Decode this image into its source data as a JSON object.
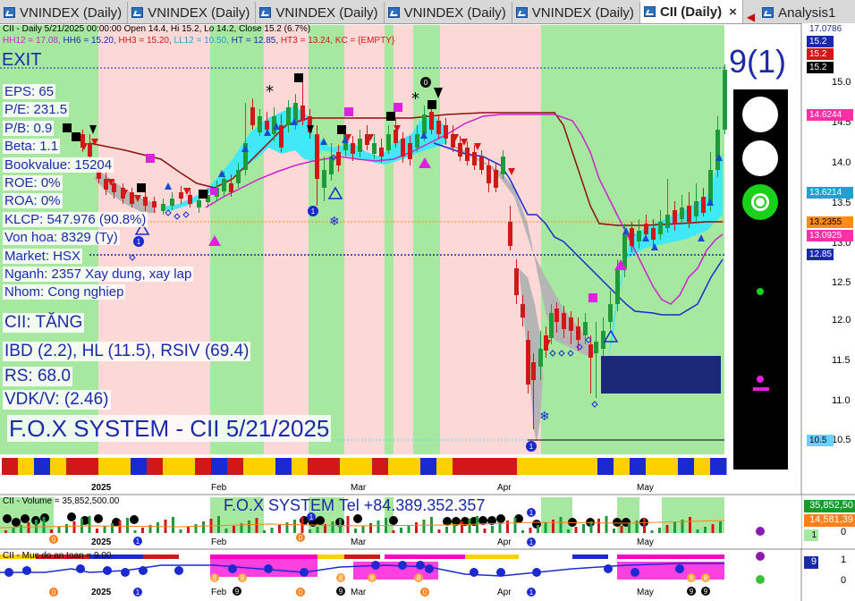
{
  "tabs": [
    {
      "label": "VNINDEX (Daily)",
      "active": false
    },
    {
      "label": "VNINDEX (Daily)",
      "active": false
    },
    {
      "label": "VNINDEX (Daily)",
      "active": false
    },
    {
      "label": "VNINDEX (Daily)",
      "active": false
    },
    {
      "label": "VNINDEX (Daily)",
      "active": false
    },
    {
      "label": "CII (Daily)",
      "active": true
    },
    {
      "label": "Analysis1",
      "active": false
    }
  ],
  "tab_close": "×",
  "tab_nav": "◀",
  "header": {
    "line1": "CII - Daily 5/21/2025 00:00:00 Open 14.4, Hi 15.2, Lo 14.2, Close 15.2 (6.7%)",
    "hh12": "HH12 = 17.08,",
    "hh6": "HH6 = 15.20,",
    "hh3": "HH3 = 15.20,",
    "ll12": "LL12 = 10.50,",
    "ht": "HT = 12.85,",
    "ht3": "HT3 = 13.24,",
    "kc": "KC = {EMPTY}"
  },
  "signal": "EXIT",
  "signal_count": "9(1)",
  "fundamentals": [
    "EPS: 65",
    "P/E: 231.5",
    "P/B: 0.9",
    "Beta: 1.1",
    "Bookvalue: 15204",
    "ROE: 0%",
    "ROA: 0%",
    "KLCP: 547.976 (90.8%)",
    "Von hoa: 8329 (Ty)",
    "Market: HSX",
    "Nganh: 2357 Xay dung, xay lap",
    "Nhom: Cong nghiep"
  ],
  "status": {
    "trend": "CII: TĂNG",
    "ibd": "IBD (2.2), HL (11.5), RSIV (69.4)",
    "rs": "RS: 68.0",
    "vdk": "VDK/V:  (2.46)"
  },
  "system_title": "F.O.X SYSTEM - CII 5/21/2025",
  "system_tel": "F.O.X SYSTEM Tel +84.389.352.357",
  "price_axis": {
    "ticks": [
      "15.0",
      "14.5",
      "14.0",
      "13.5",
      "13.0",
      "12.5",
      "12.0",
      "11.5",
      "11.0",
      "10.5"
    ],
    "tags": [
      {
        "label": "17.0786",
        "color": "#ffffff",
        "text": "#1a2aa8"
      },
      {
        "label": "15.2",
        "color": "#1a2aa8",
        "text": "#ffffff"
      },
      {
        "label": "15.2",
        "color": "#d01818",
        "text": "#ffffff"
      },
      {
        "label": "15.2",
        "color": "#000000",
        "text": "#ffffff"
      },
      {
        "label": "14.6244",
        "color": "#ff2fa8",
        "text": "#ffffff"
      },
      {
        "label": "13.6214",
        "color": "#20a0d0",
        "text": "#ffffff"
      },
      {
        "label": "13.2355",
        "color": "#ff8c1a",
        "text": "#000000"
      },
      {
        "label": "13.0925",
        "color": "#ff2fa8",
        "text": "#ffffff"
      },
      {
        "label": "12.85",
        "color": "#1a2aa8",
        "text": "#ffffff"
      },
      {
        "label": "10.5",
        "color": "#6ad0ff",
        "text": "#000000"
      }
    ]
  },
  "months": [
    "2025",
    "Feb",
    "Mar",
    "Apr",
    "May"
  ],
  "volume": {
    "label": "CII - Volume = 35,852,500.00",
    "tag1": "35,852,50",
    "tag2": "14,581,39",
    "axis1": "1",
    "axis0": "0"
  },
  "safety": {
    "label": "CII - Muc do an toan = 9.00",
    "tag": "9",
    "axis1": "1",
    "axis0": "0"
  },
  "markers": {
    "one": "1",
    "zero": "0",
    "eight": "8",
    "nine": "9"
  },
  "colors": {
    "up": "#1f9a3a",
    "down": "#d01818",
    "green_zone": "#a6e8a0",
    "pink_zone": "#fcd9d6",
    "accent": "#1a2aa8",
    "cyan_fill": "#40e8f8",
    "grey_fill": "#b0b0b0",
    "navy_box": "#1a2a78"
  }
}
